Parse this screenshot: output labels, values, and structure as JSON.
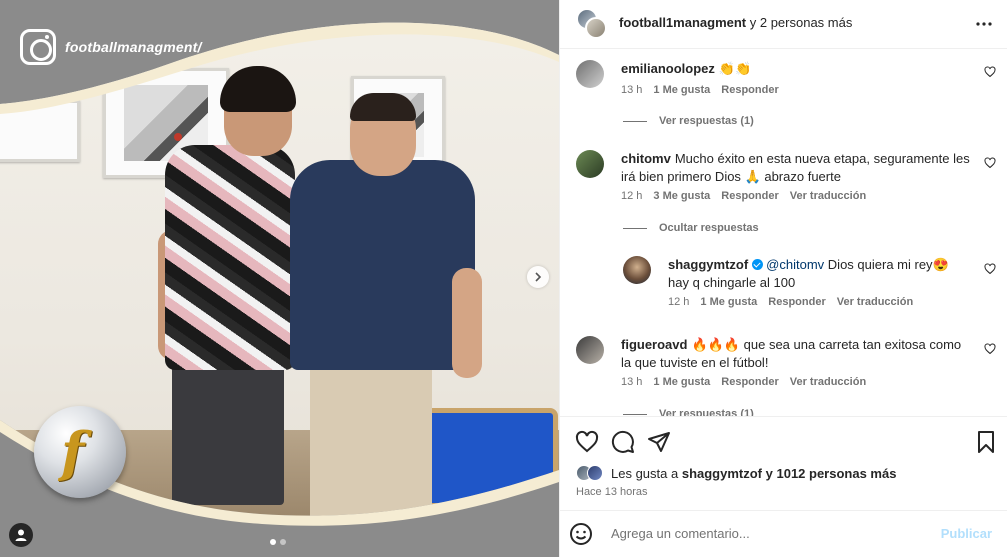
{
  "photo": {
    "brand_handle": "footballmanagment/",
    "carousel_dots": 2,
    "active_dot": 1
  },
  "header": {
    "username": "football1managment",
    "suffix": "y 2 personas más"
  },
  "comments": [
    {
      "user": "emilianoolopez",
      "text": "👏👏",
      "time": "13 h",
      "likes": "1 Me gusta",
      "reply": "Responder",
      "translate": "",
      "view_replies": "Ver respuestas (1)"
    },
    {
      "user": "chitomv",
      "text": "Mucho éxito en esta nueva etapa, seguramente les irá bien primero Dios 🙏 abrazo fuerte",
      "time": "12 h",
      "likes": "3 Me gusta",
      "reply": "Responder",
      "translate": "Ver traducción",
      "hide_replies": "Ocultar respuestas"
    },
    {
      "user": "shaggymtzof",
      "mention": "@chitomv",
      "text": "Dios quiera mi rey😍 hay q chingarle al 100",
      "time": "12 h",
      "likes": "1 Me gusta",
      "reply": "Responder",
      "translate": "Ver traducción"
    },
    {
      "user": "figueroavd",
      "text": "🔥🔥🔥 que sea una carreta tan exitosa como la que tuviste en el fútbol!",
      "time": "13 h",
      "likes": "1 Me gusta",
      "reply": "Responder",
      "translate": "Ver traducción",
      "view_replies": "Ver respuestas (1)"
    }
  ],
  "likes": {
    "prefix": "Les gusta a",
    "user": "shaggymtzof",
    "suffix": "y 1012 personas más"
  },
  "posted": "Hace 13 horas",
  "compose": {
    "placeholder": "Agrega un comentario...",
    "post_label": "Publicar"
  },
  "colors": {
    "link": "#00376b",
    "muted": "#737373",
    "post_disabled": "#b2dffc",
    "verified": "#0095f6"
  }
}
